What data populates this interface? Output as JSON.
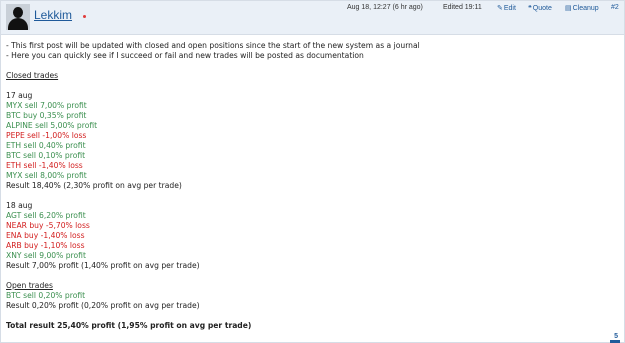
{
  "post": {
    "username": "Lekkim",
    "timestamp": "Aug 18, 12:27 (6 hr ago)",
    "edited": "Edited 19:11",
    "actions": {
      "edit": "Edit",
      "quote": "Quote",
      "cleanup": "Cleanup",
      "post_number": "#2"
    },
    "intro": [
      "- This first post will be updated with closed and open positions since the start of the new system as a journal",
      "- Here you can quickly see if I succeed or fail and new trades will be posted as documentation"
    ],
    "closed_trades_heading": "Closed trades",
    "days": [
      {
        "date": "17 aug",
        "trades": [
          {
            "text": "MYX sell 7,00% profit",
            "result": "profit"
          },
          {
            "text": "BTC buy 0,35% profit",
            "result": "profit"
          },
          {
            "text": "ALPINE sell 5,00% profit",
            "result": "profit"
          },
          {
            "text": "PEPE sell -1,00% loss",
            "result": "loss"
          },
          {
            "text": "ETH sell 0,40% profit",
            "result": "profit"
          },
          {
            "text": "BTC sell 0,10% profit",
            "result": "profit"
          },
          {
            "text": "ETH sell -1,40% loss",
            "result": "loss"
          },
          {
            "text": "MYX sell 8,00% profit",
            "result": "profit"
          }
        ],
        "result": "Result 18,40% (2,30% profit on avg per trade)"
      },
      {
        "date": "18 aug",
        "trades": [
          {
            "text": "AGT sell 6,20% profit",
            "result": "profit"
          },
          {
            "text": "NEAR buy -5,70% loss",
            "result": "loss"
          },
          {
            "text": "ENA buy -1,40% loss",
            "result": "loss"
          },
          {
            "text": "ARB buy -1,10% loss",
            "result": "loss"
          },
          {
            "text": "XNY sell 9,00% profit",
            "result": "profit"
          }
        ],
        "result": "Result 7,00% profit (1,40% profit on avg per trade)"
      }
    ],
    "open_trades": {
      "heading": "Open trades",
      "trades": [
        {
          "text": "BTC sell 0,20% profit",
          "result": "profit"
        }
      ],
      "result": "Result 0,20% profit (0,20% profit on avg per trade)"
    },
    "total": "Total result 25,40% profit (1,95% profit on avg per trade)",
    "likes": "5",
    "colors": {
      "profit": "#3a8f4e",
      "loss": "#d21d1d",
      "link": "#1f5a9a",
      "header_bg": "#eaf0f7"
    },
    "icons": {
      "edit": "pencil-icon",
      "quote": "quote-icon",
      "cleanup": "cleanup-icon"
    }
  }
}
